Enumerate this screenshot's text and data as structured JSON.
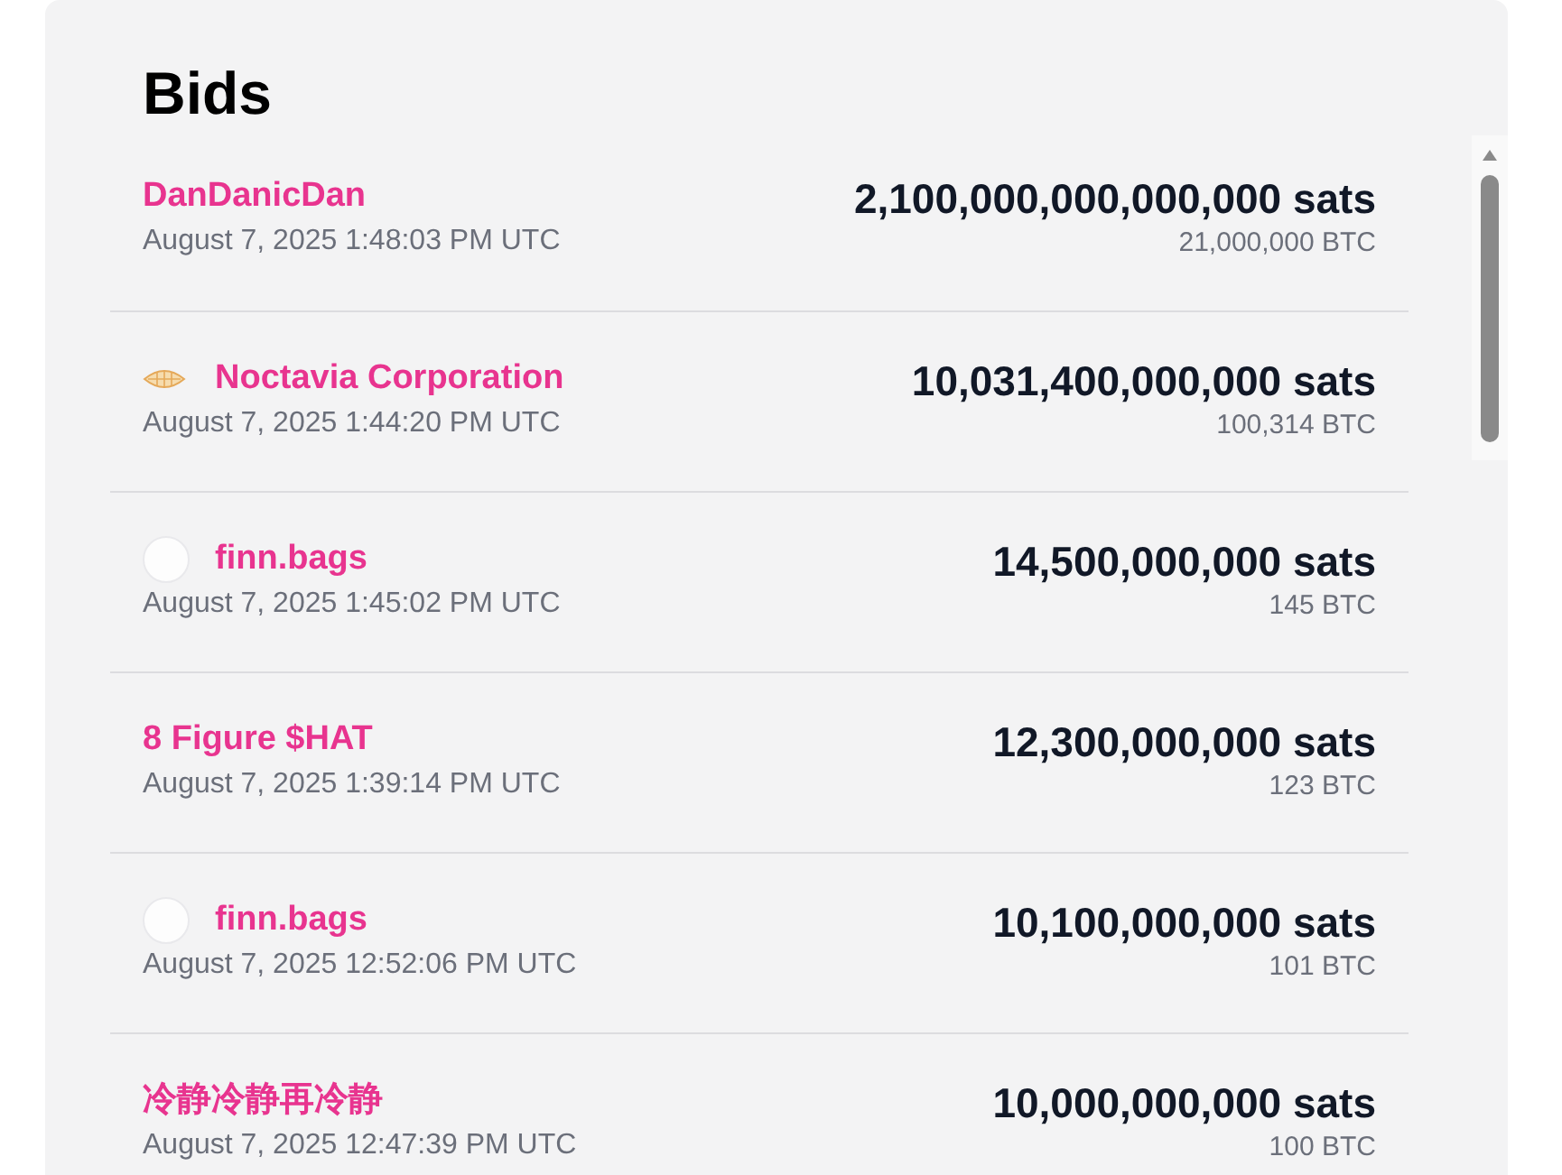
{
  "title": "Bids",
  "bids": [
    {
      "bidder": "DanDanicDan",
      "kind": "plain",
      "time": "August 7, 2025 1:48:03 PM UTC",
      "amount": "2,100,000,000,000,000 sats",
      "btc": "21,000,000 BTC"
    },
    {
      "bidder": "Noctavia Corporation",
      "kind": "logo",
      "time": "August 7, 2025 1:44:20 PM UTC",
      "amount": "10,031,400,000,000 sats",
      "btc": "100,314 BTC"
    },
    {
      "bidder": "finn.bags",
      "kind": "avatar",
      "time": "August 7, 2025 1:45:02 PM UTC",
      "amount": "14,500,000,000 sats",
      "btc": "145 BTC"
    },
    {
      "bidder": "8 Figure $HAT",
      "kind": "plain",
      "time": "August 7, 2025 1:39:14 PM UTC",
      "amount": "12,300,000,000 sats",
      "btc": "123 BTC"
    },
    {
      "bidder": "finn.bags",
      "kind": "avatar",
      "time": "August 7, 2025 12:52:06 PM UTC",
      "amount": "10,100,000,000 sats",
      "btc": "101 BTC"
    },
    {
      "bidder": "冷静冷静再冷静",
      "kind": "plain",
      "time": "August 7, 2025 12:47:39 PM UTC",
      "amount": "10,000,000,000 sats",
      "btc": "100 BTC"
    }
  ]
}
